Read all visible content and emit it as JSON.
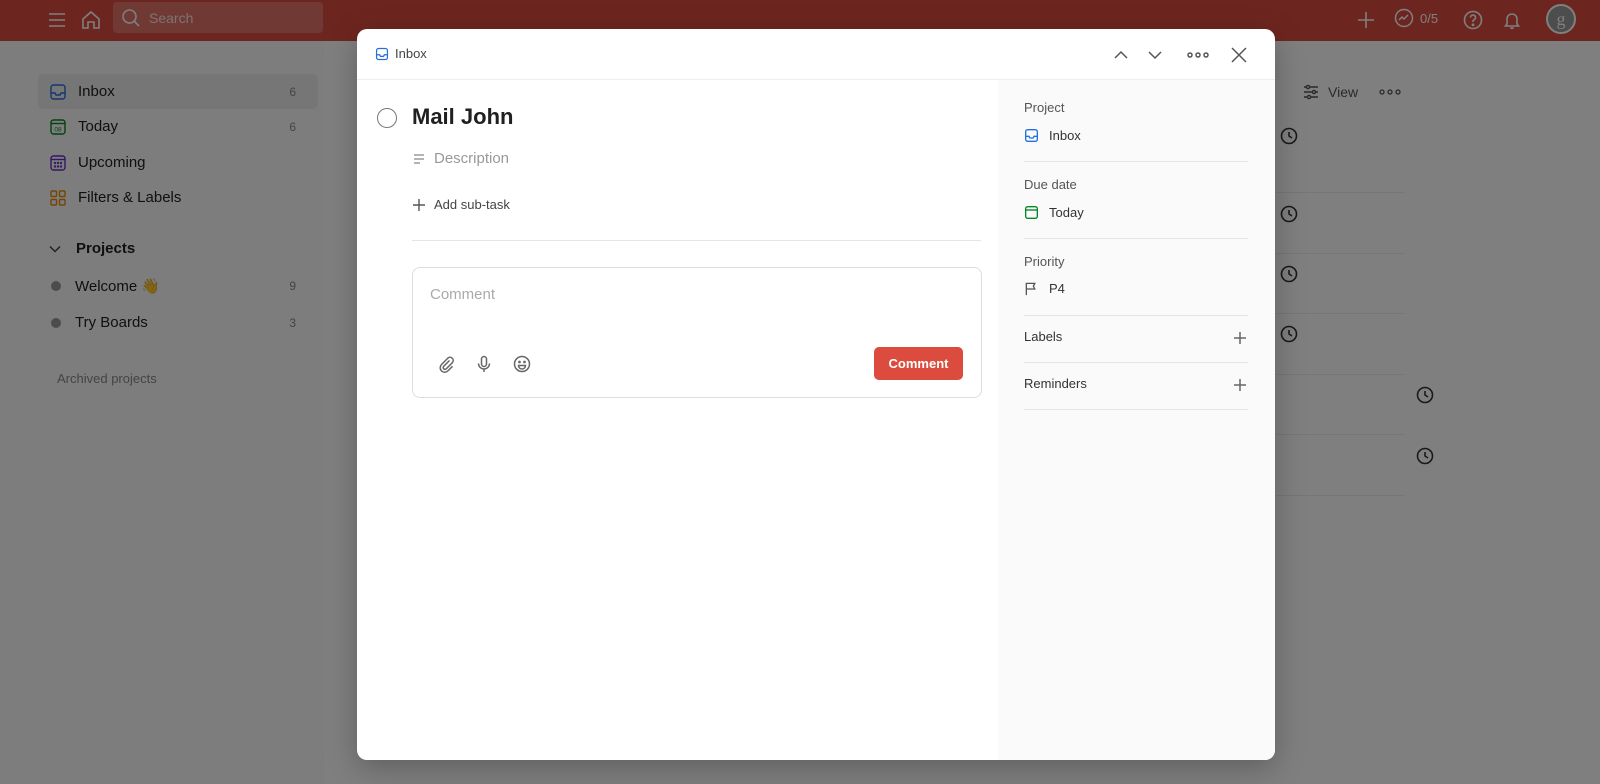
{
  "topbar": {
    "search_placeholder": "Search",
    "karma": "0/5",
    "avatar_letter": "g"
  },
  "sidebar": {
    "items": [
      {
        "label": "Inbox",
        "count": "6"
      },
      {
        "label": "Today",
        "count": "6",
        "icon_text": "08"
      },
      {
        "label": "Upcoming"
      },
      {
        "label": "Filters & Labels"
      }
    ],
    "projects_heading": "Projects",
    "projects": [
      {
        "label": "Welcome 👋",
        "count": "9"
      },
      {
        "label": "Try Boards",
        "count": "3"
      }
    ],
    "archived": "Archived projects"
  },
  "main": {
    "view_label": "View"
  },
  "modal": {
    "breadcrumb": "Inbox",
    "task_title": "Mail John",
    "description_placeholder": "Description",
    "add_subtask": "Add sub-task",
    "comment_placeholder": "Comment",
    "comment_button": "Comment",
    "side": {
      "project_label": "Project",
      "project_value": "Inbox",
      "due_label": "Due date",
      "due_value": "Today",
      "priority_label": "Priority",
      "priority_value": "P4",
      "labels_label": "Labels",
      "reminders_label": "Reminders"
    }
  },
  "colors": {
    "brand": "#db4c3f",
    "inbox_blue": "#246fe0",
    "today_green": "#058527",
    "upcoming_purple": "#692fc2",
    "filters_orange": "#eb8909"
  }
}
